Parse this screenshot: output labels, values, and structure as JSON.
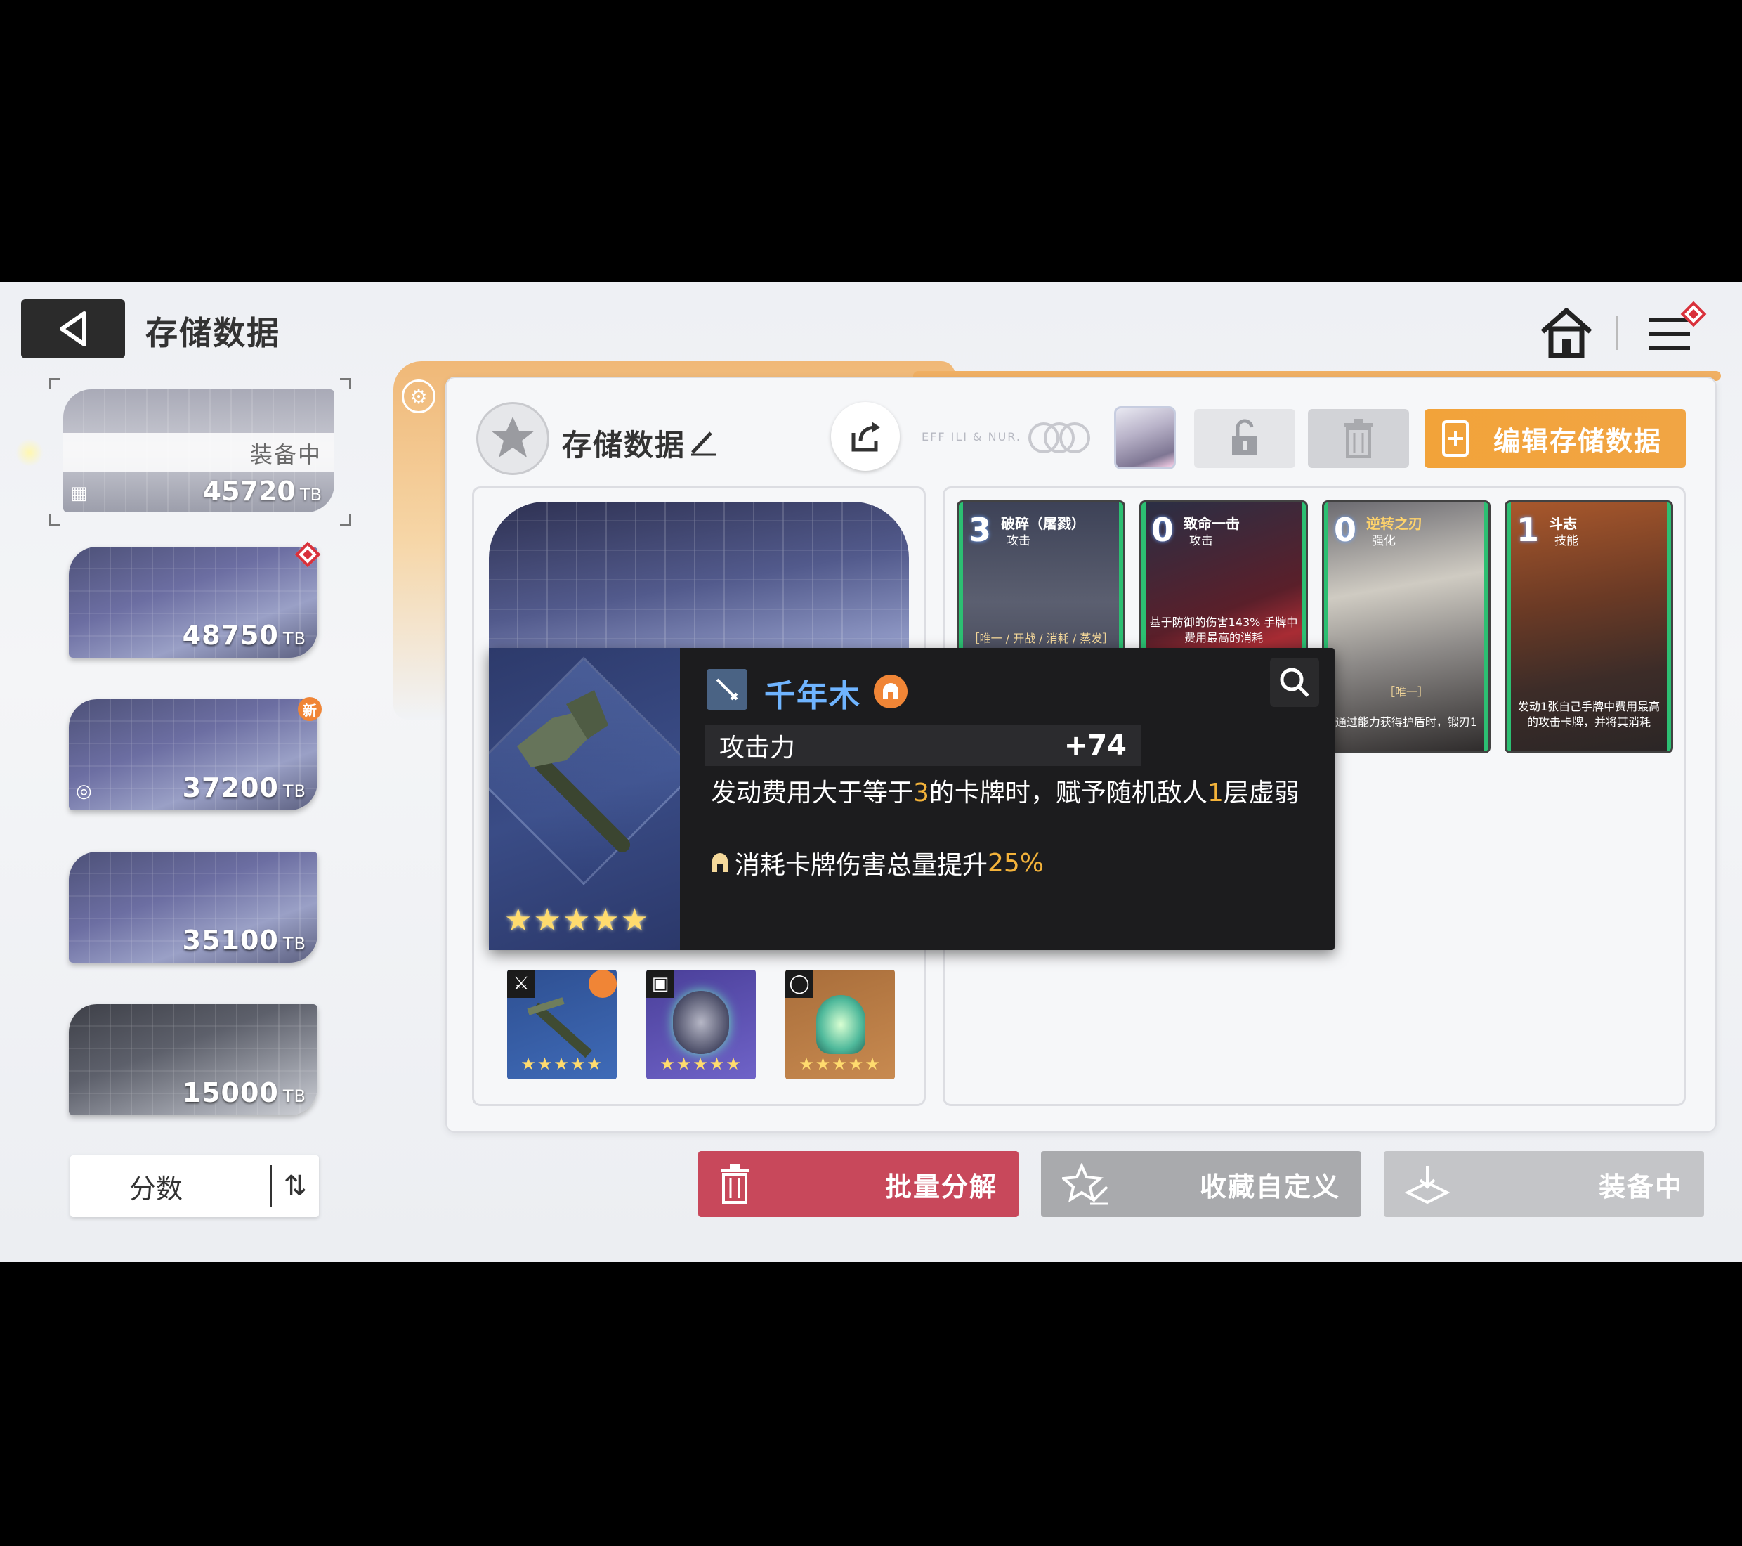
{
  "header": {
    "title": "存储数据"
  },
  "storage_slots": [
    {
      "status": "装备中",
      "value": "45720",
      "unit": "TB",
      "active": true
    },
    {
      "value": "48750",
      "unit": "TB",
      "badge": "diamond"
    },
    {
      "value": "37200",
      "unit": "TB",
      "badge": "新"
    },
    {
      "value": "35100",
      "unit": "TB"
    },
    {
      "value": "15000",
      "unit": "TB"
    }
  ],
  "sort": {
    "label": "分数"
  },
  "panel": {
    "title": "存储数据",
    "faint_text": "EFF ILI & NUR.",
    "edit_button": "编辑存储数据"
  },
  "skill_cards": [
    {
      "cost": "3",
      "name": "破碎（屠戮）",
      "type": "攻击",
      "tag": "［唯一 / 开战 / 消耗 / 蒸发］",
      "desc": ""
    },
    {
      "cost": "0",
      "name": "致命一击",
      "type": "攻击",
      "tag": "",
      "desc": "基于防御的伤害143% 手牌中费用最高的消耗"
    },
    {
      "cost": "0",
      "name": "逆转之刃",
      "type": "强化",
      "tag": "［唯一］",
      "desc": "通过能力获得护盾时，锻刃1"
    },
    {
      "cost": "1",
      "name": "斗志",
      "type": "技能",
      "tag": "",
      "desc": "发动1张自己手牌中费用最高的攻击卡牌，并将其消耗"
    }
  ],
  "tooltip": {
    "name": "千年木",
    "stars": "★★★★★",
    "stat_label": "攻击力",
    "stat_value": "+74",
    "desc_pre": "发动费用大于等于",
    "desc_num1": "3",
    "desc_mid": "的卡牌时，赋予随机敌人",
    "desc_num2": "1",
    "desc_post": "层虚弱",
    "bonus_pre": "消耗卡牌伤害总量提升",
    "bonus_num": "25%"
  },
  "equipment": [
    {
      "name": "weapon",
      "stars": "★★★★★"
    },
    {
      "name": "armor",
      "stars": "★★★★★"
    },
    {
      "name": "accessory",
      "stars": "★★★★★"
    }
  ],
  "bottom_buttons": {
    "decompose": "批量分解",
    "collect": "收藏自定义",
    "equipped": "装备中"
  },
  "colors": {
    "accent_orange": "#f2a33a",
    "danger_red": "#c8485b",
    "name_blue": "#6fb4ff",
    "highlight": "#f4b33a"
  }
}
